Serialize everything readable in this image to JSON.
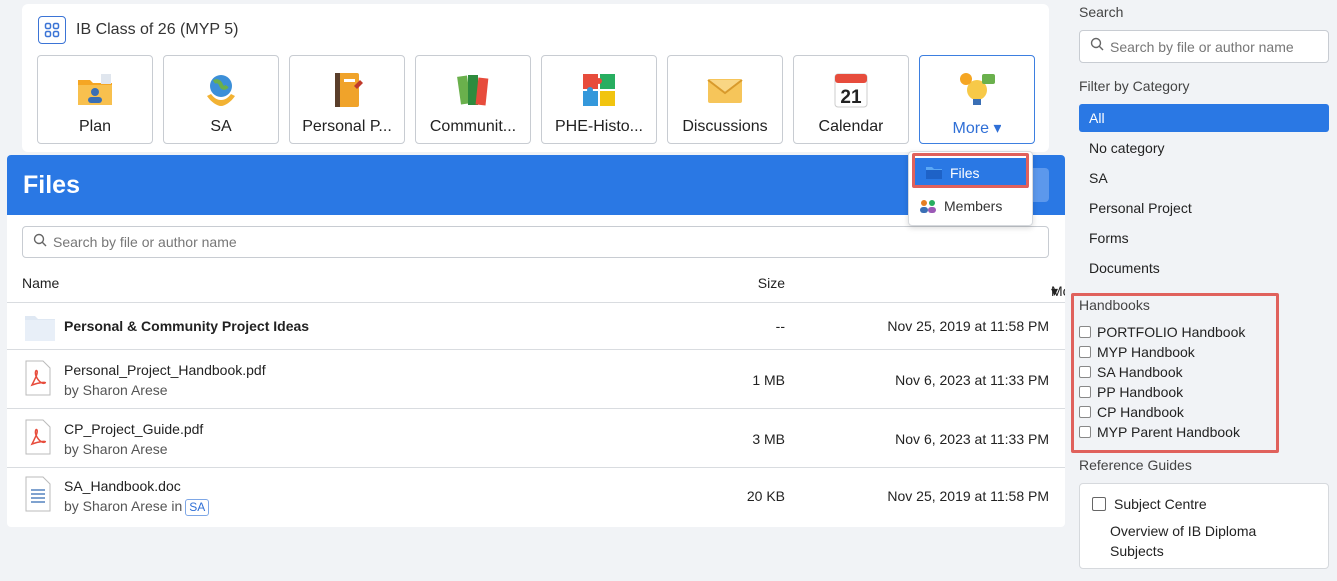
{
  "course": {
    "title": "IB Class of 26 (MYP 5)",
    "tiles": [
      {
        "label": "Plan",
        "icon": "folder-person-icon"
      },
      {
        "label": "SA",
        "icon": "globe-hands-icon"
      },
      {
        "label": "Personal P...",
        "icon": "notebook-icon"
      },
      {
        "label": "Communit...",
        "icon": "books-icon"
      },
      {
        "label": "PHE-Histo...",
        "icon": "puzzle-icon"
      },
      {
        "label": "Discussions",
        "icon": "envelope-icon"
      },
      {
        "label": "Calendar",
        "icon": "calendar-icon",
        "day": "21"
      },
      {
        "label": "More",
        "icon": "lightbulb-chat-icon",
        "caret": "▾"
      }
    ]
  },
  "dropdown": {
    "items": [
      {
        "label": "Files",
        "icon": "folder-icon"
      },
      {
        "label": "Members",
        "icon": "members-icon"
      }
    ]
  },
  "files": {
    "title": "Files",
    "search_placeholder": "Search by file or author name",
    "columns": {
      "name": "Name",
      "size": "Size",
      "modified": "Modified",
      "sort_caret": "▾"
    },
    "rows": [
      {
        "name": "Personal & Community Project Ideas",
        "sub": "",
        "size": "--",
        "modified": "Nov 25, 2019 at 11:58 PM",
        "type": "folder"
      },
      {
        "name": "Personal_Project_Handbook.pdf",
        "sub": "by Sharon Arese",
        "size": "1 MB",
        "modified": "Nov 6, 2023 at 11:33 PM",
        "type": "pdf"
      },
      {
        "name": "CP_Project_Guide.pdf",
        "sub": "by Sharon Arese",
        "size": "3 MB",
        "modified": "Nov 6, 2023 at 11:33 PM",
        "type": "pdf"
      },
      {
        "name": "SA_Handbook.doc",
        "sub": "by Sharon Arese in",
        "tag": "SA",
        "size": "20 KB",
        "modified": "Nov 25, 2019 at 11:58 PM",
        "type": "doc"
      }
    ]
  },
  "sidebar": {
    "search_heading": "Search",
    "search_placeholder": "Search by file or author name",
    "filter_heading": "Filter by Category",
    "categories": [
      "All",
      "No category",
      "SA",
      "Personal Project",
      "Forms",
      "Documents"
    ],
    "handbooks_heading": "Handbooks",
    "handbooks": [
      "PORTFOLIO Handbook",
      "MYP Handbook",
      "SA Handbook",
      "PP Handbook",
      "CP Handbook",
      "MYP Parent Handbook"
    ],
    "reference_heading": "Reference Guides",
    "reference": {
      "title": "Subject Centre",
      "description": "Overview of IB Diploma Subjects"
    }
  },
  "colors": {
    "accent": "#2a78e4",
    "highlight": "#e0615c"
  }
}
